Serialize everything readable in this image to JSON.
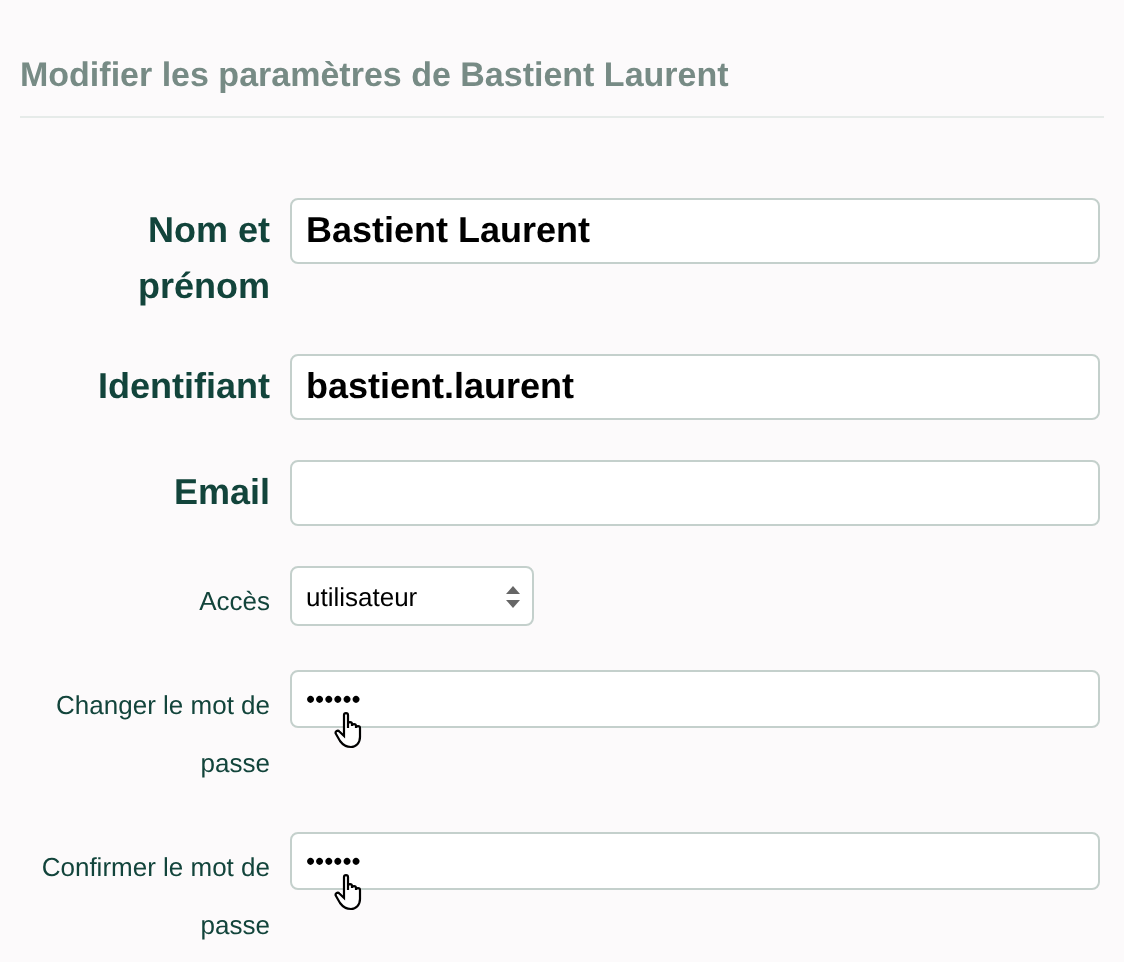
{
  "heading": "Modifier les paramètres de Bastient Laurent",
  "fields": [
    {
      "kind": "text",
      "label": "Nom et prénom",
      "bold": true,
      "value": "Bastient Laurent"
    },
    {
      "kind": "text",
      "label": "Identifiant",
      "bold": true,
      "value": "bastient.laurent"
    },
    {
      "kind": "text",
      "label": "Email",
      "bold": true
    },
    {
      "kind": "select",
      "label": "Accès",
      "bold": false,
      "value": "utilisateur"
    },
    {
      "kind": "password",
      "label": "Changer le mot de passe",
      "bold": false,
      "value": "••••••"
    },
    {
      "kind": "password",
      "label": "Confirmer le mot de passe",
      "bold": false,
      "value": "••••••"
    }
  ]
}
